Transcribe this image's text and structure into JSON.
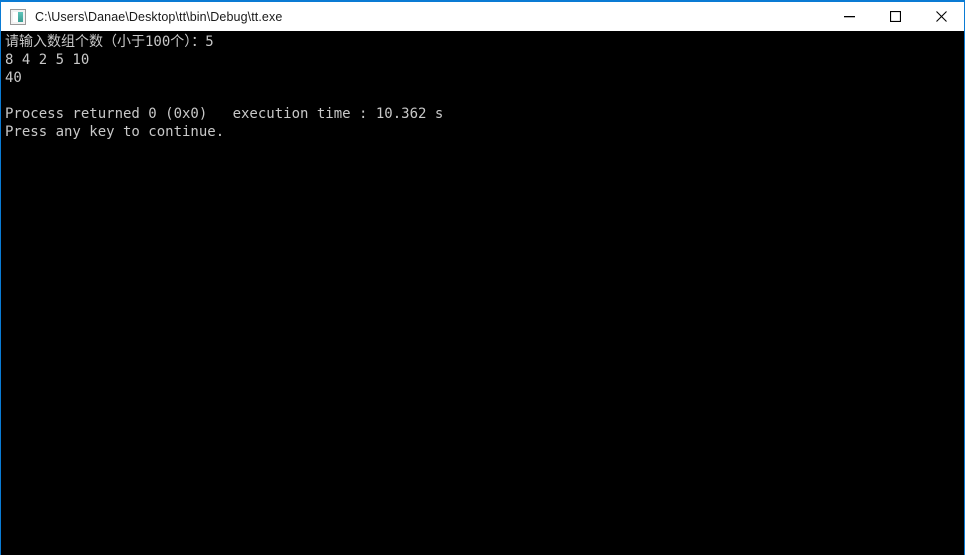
{
  "window": {
    "title": "C:\\Users\\Danae\\Desktop\\tt\\bin\\Debug\\tt.exe",
    "icon": "console-app-icon",
    "accent_color": "#0a7bd4",
    "titlebar_background": "#ffffff",
    "console_background": "#000000",
    "console_text_color": "#c8c8c8",
    "controls": {
      "minimize_label": "—",
      "maximize_label": "□",
      "close_label": "✕"
    }
  },
  "console": {
    "lines": [
      "请输入数组个数（小于100个）：5",
      "8 4 2 5 10",
      "40",
      "",
      "Process returned 0 (0x0)   execution time : 10.362 s",
      "Press any key to continue."
    ]
  }
}
